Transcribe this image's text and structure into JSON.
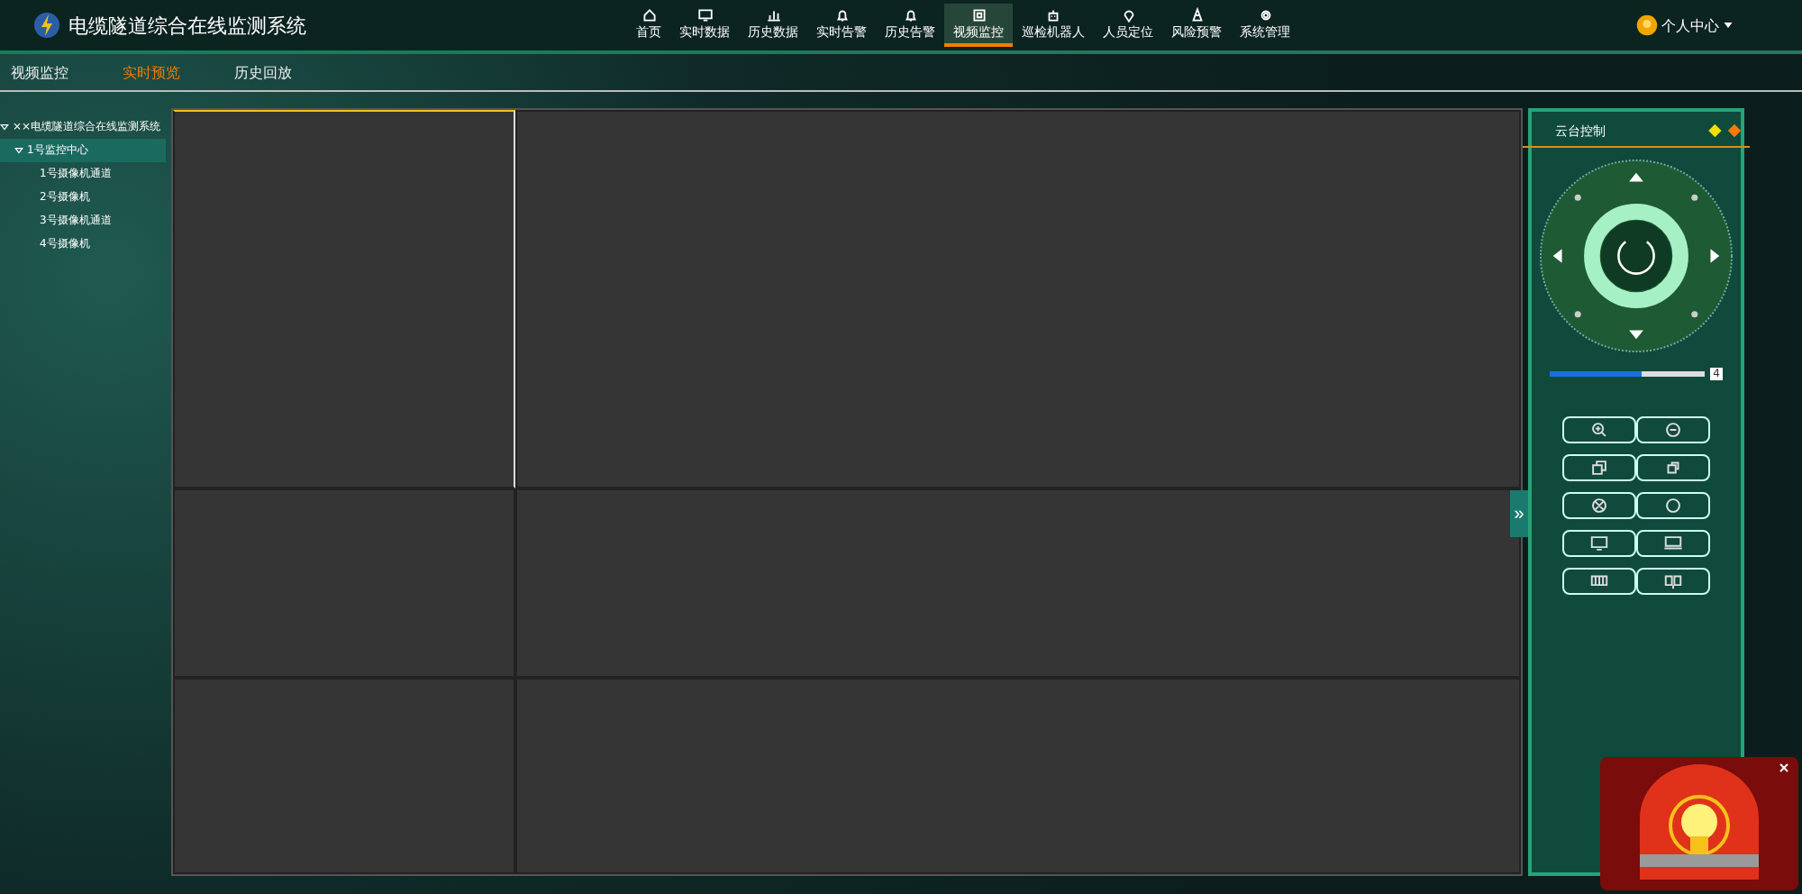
{
  "header": {
    "title": "电缆隧道综合在线监测系统",
    "user": "个人中心"
  },
  "nav": [
    {
      "label": "首页",
      "kind": "home",
      "selected": false
    },
    {
      "label": "实时数据",
      "kind": "monitor",
      "selected": false
    },
    {
      "label": "历史数据",
      "kind": "chart",
      "selected": false
    },
    {
      "label": "实时告警",
      "kind": "bell",
      "selected": false
    },
    {
      "label": "历史告警",
      "kind": "bell",
      "selected": false
    },
    {
      "label": "视频监控",
      "kind": "camera",
      "selected": true
    },
    {
      "label": "巡检机器人",
      "kind": "robot",
      "selected": false
    },
    {
      "label": "人员定位",
      "kind": "pin",
      "selected": false
    },
    {
      "label": "风险预警",
      "kind": "cone",
      "selected": false
    },
    {
      "label": "系统管理",
      "kind": "gear",
      "selected": false
    }
  ],
  "subtabs": [
    {
      "label": "视频监控",
      "selected": false
    },
    {
      "label": "实时预览",
      "selected": true
    },
    {
      "label": "历史回放",
      "selected": false
    }
  ],
  "tree": {
    "label": "××电缆隧道综合在线监测系统",
    "expanded": true,
    "children": [
      {
        "label": "1号监控中心",
        "expanded": true,
        "selected": true,
        "children": [
          {
            "label": "1号摄像机通道",
            "selected": false
          },
          {
            "label": "2号摄像机",
            "selected": false
          },
          {
            "label": "3号摄像机通道",
            "selected": false
          },
          {
            "label": "4号摄像机",
            "selected": false
          }
        ]
      }
    ]
  },
  "video_cells": [
    {
      "selected": true
    },
    {
      "selected": false
    },
    {
      "selected": false
    },
    {
      "selected": false
    },
    {
      "selected": false
    },
    {
      "selected": false
    }
  ],
  "ptz": {
    "title": "云台控制",
    "speed": {
      "level": 0.6,
      "reading": "4"
    },
    "buttons": [
      {
        "kind": "zoomin"
      },
      {
        "kind": "zoomout"
      },
      {
        "kind": "near"
      },
      {
        "kind": "far"
      },
      {
        "kind": "open"
      },
      {
        "kind": "close"
      },
      {
        "kind": "lighton"
      },
      {
        "kind": "lightoff"
      },
      {
        "kind": "wiperon"
      },
      {
        "kind": "wiperoff"
      }
    ]
  },
  "expand_handle": "»"
}
